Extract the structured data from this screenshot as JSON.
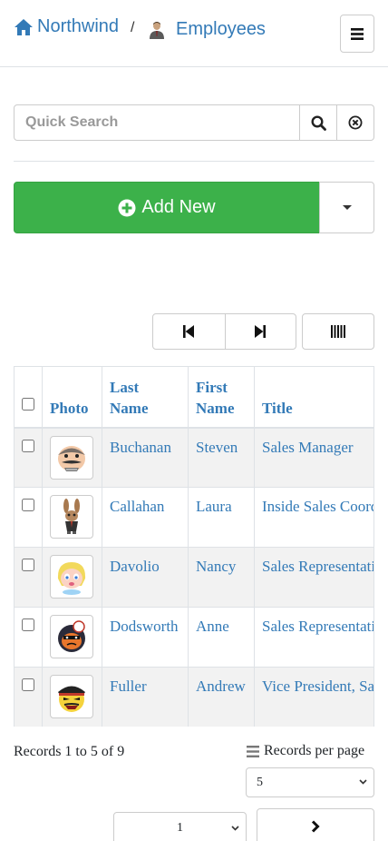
{
  "header": {
    "brand": "Northwind",
    "separator": "/",
    "current": "Employees",
    "brand_color": "#337ab7"
  },
  "search": {
    "placeholder": "Quick Search",
    "value": ""
  },
  "actions": {
    "add_label": "Add New",
    "add_color": "#3cb14a"
  },
  "grid": {
    "columns": [
      "Photo",
      "Last Name",
      "First Name",
      "Title"
    ],
    "rows": [
      {
        "last": "Buchanan",
        "first": "Steven",
        "title": "Sales Manager",
        "avatar": "mustache-man-avatar"
      },
      {
        "last": "Callahan",
        "first": "Laura",
        "title": "Inside Sales Coordinator",
        "avatar": "rabbit-avatar"
      },
      {
        "last": "Davolio",
        "first": "Nancy",
        "title": "Sales Representative",
        "avatar": "blonde-girl-avatar"
      },
      {
        "last": "Dodsworth",
        "first": "Anne",
        "title": "Sales Representative",
        "avatar": "bomb-face-avatar"
      },
      {
        "last": "Fuller",
        "first": "Andrew",
        "title": "Vice President, Sales",
        "avatar": "officer-cap-avatar"
      }
    ]
  },
  "footer": {
    "records": "Records 1 to 5 of 9",
    "records_per_page_label": "Records per page",
    "records_per_page": "5",
    "page": "1"
  }
}
